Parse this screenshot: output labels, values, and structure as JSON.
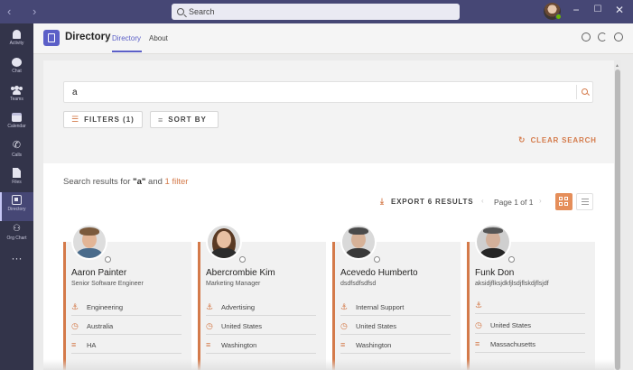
{
  "titlebar": {
    "search_placeholder": "Search",
    "minimize": "−",
    "maximize": "☐",
    "close": "✕"
  },
  "rail": {
    "items": [
      {
        "label": "Activity",
        "icon": "bell-icon"
      },
      {
        "label": "Chat",
        "icon": "chat-icon"
      },
      {
        "label": "Teams",
        "icon": "teams-icon"
      },
      {
        "label": "Calendar",
        "icon": "calendar-icon"
      },
      {
        "label": "Calls",
        "icon": "phone-icon"
      },
      {
        "label": "Files",
        "icon": "file-icon"
      },
      {
        "label": "Directory",
        "icon": "directory-icon"
      },
      {
        "label": "Org Chart",
        "icon": "org-chart-icon"
      }
    ],
    "more": "···"
  },
  "app": {
    "title": "Directory",
    "tabs": [
      "Directory",
      "About"
    ]
  },
  "search": {
    "query": "a"
  },
  "controls": {
    "filters_label": "FILTERS (1)",
    "sort_label": "SORT BY",
    "clear_label": "CLEAR SEARCH"
  },
  "results": {
    "prefix": "Search results for ",
    "query_quoted": "\"a\"",
    "middle": " and ",
    "filter_link": "1 filter",
    "export_label": "EXPORT 6 RESULTS",
    "page_info": "Page 1 of 1"
  },
  "colors": {
    "accent": "#d47a4a",
    "teams_purple": "#464775",
    "brand": "#5b5fc7"
  },
  "people": [
    {
      "name": "Aaron Painter",
      "title": "Senior Software Engineer",
      "department": "Engineering",
      "location": "Australia",
      "state": "HA"
    },
    {
      "name": "Abercrombie Kim",
      "title": "Marketing Manager",
      "department": "Advertising",
      "location": "United States",
      "state": "Washington"
    },
    {
      "name": "Acevedo Humberto",
      "title": "dsdfsdfsdfsd",
      "department": "Internal Support",
      "location": "United States",
      "state": "Washington"
    },
    {
      "name": "Funk Don",
      "title": "aksidjflksjdkfjlsdjflskdjflsjdf",
      "department": "",
      "location": "United States",
      "state": "Massachusetts"
    }
  ]
}
